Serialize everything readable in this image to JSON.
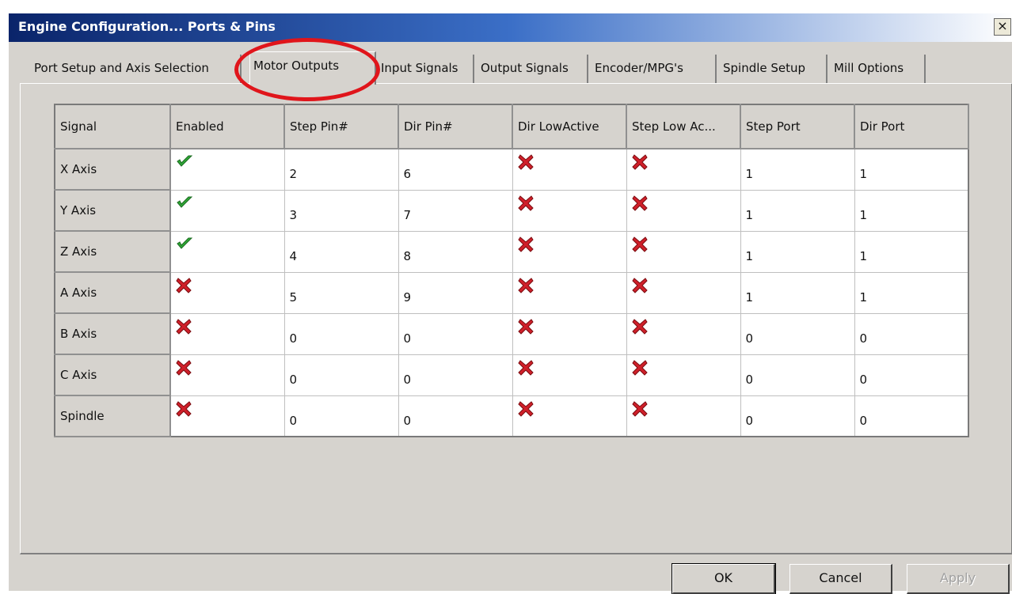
{
  "window": {
    "title": "Engine Configuration... Ports & Pins",
    "close_label": "×"
  },
  "tabs": [
    {
      "label": "Port Setup and Axis Selection",
      "active": false
    },
    {
      "label": "Motor Outputs",
      "active": true
    },
    {
      "label": "Input Signals",
      "active": false
    },
    {
      "label": "Output Signals",
      "active": false
    },
    {
      "label": "Encoder/MPG's",
      "active": false
    },
    {
      "label": "Spindle Setup",
      "active": false
    },
    {
      "label": "Mill Options",
      "active": false
    }
  ],
  "grid": {
    "headers": [
      "Signal",
      "Enabled",
      "Step Pin#",
      "Dir Pin#",
      "Dir LowActive",
      "Step Low Ac...",
      "Step Port",
      "Dir Port"
    ],
    "rows": [
      {
        "signal": "X Axis",
        "enabled": true,
        "step_pin": "2",
        "dir_pin": "6",
        "dir_low_active": false,
        "step_low_active": false,
        "step_port": "1",
        "dir_port": "1"
      },
      {
        "signal": "Y Axis",
        "enabled": true,
        "step_pin": "3",
        "dir_pin": "7",
        "dir_low_active": false,
        "step_low_active": false,
        "step_port": "1",
        "dir_port": "1"
      },
      {
        "signal": "Z Axis",
        "enabled": true,
        "step_pin": "4",
        "dir_pin": "8",
        "dir_low_active": false,
        "step_low_active": false,
        "step_port": "1",
        "dir_port": "1"
      },
      {
        "signal": "A Axis",
        "enabled": false,
        "step_pin": "5",
        "dir_pin": "9",
        "dir_low_active": false,
        "step_low_active": false,
        "step_port": "1",
        "dir_port": "1"
      },
      {
        "signal": "B Axis",
        "enabled": false,
        "step_pin": "0",
        "dir_pin": "0",
        "dir_low_active": false,
        "step_low_active": false,
        "step_port": "0",
        "dir_port": "0"
      },
      {
        "signal": "C Axis",
        "enabled": false,
        "step_pin": "0",
        "dir_pin": "0",
        "dir_low_active": false,
        "step_low_active": false,
        "step_port": "0",
        "dir_port": "0"
      },
      {
        "signal": "Spindle",
        "enabled": false,
        "step_pin": "0",
        "dir_pin": "0",
        "dir_low_active": false,
        "step_low_active": false,
        "step_port": "0",
        "dir_port": "0"
      }
    ]
  },
  "icons": {
    "checked": "green-check-icon",
    "unchecked": "red-x-icon"
  },
  "buttons": {
    "ok": "OK",
    "cancel": "Cancel",
    "apply": "Apply"
  },
  "colors": {
    "title_bar": "#0a246a",
    "dialog_bg": "#d6d3ce",
    "check_green": "#2fa836",
    "x_red": "#d0202a",
    "annotation_red": "#e0151b"
  }
}
